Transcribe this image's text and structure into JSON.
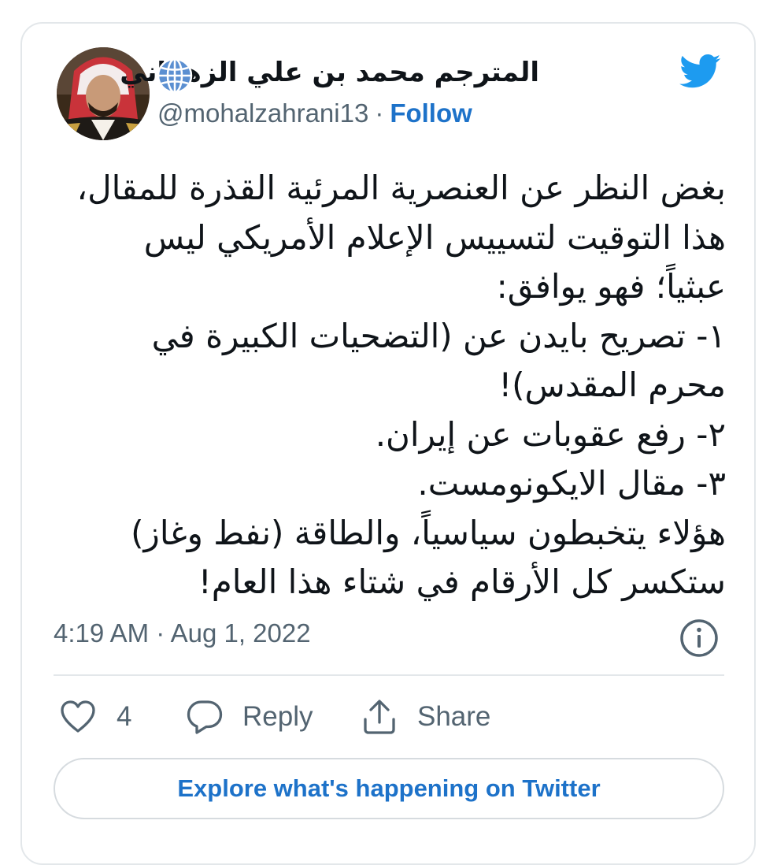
{
  "author": {
    "display_name": "المترجم محمد بن علي الزهراني",
    "handle": "@mohalzahrani13",
    "separator": "·",
    "follow_label": "Follow"
  },
  "tweet": {
    "lines": [
      "بغض النظر عن العنصرية المرئية القذرة للمقال،",
      "هذا التوقيت لتسييس الإعلام الأمريكي ليس",
      "عبثياً؛ فهو يوافق:",
      "١- تصريح بايدن عن (التضحيات الكبيرة في",
      "محرم المقدس)!",
      "٢- رفع عقوبات عن إيران.",
      "٣- مقال الايكونومست.",
      "هؤلاء يتخبطون سياسياً، والطاقة (نفط وغاز)",
      "ستكسر كل الأرقام في شتاء هذا العام!"
    ],
    "time": "4:19 AM",
    "separator": "·",
    "date": "Aug 1, 2022"
  },
  "actions": {
    "like_count": "4",
    "reply_label": "Reply",
    "share_label": "Share"
  },
  "explore_label": "Explore what's happening on Twitter",
  "icons": {
    "brand": "twitter-bird-icon",
    "verified_type": "globe-icon",
    "info": "info-icon",
    "like": "heart-icon",
    "reply": "speech-bubble-icon",
    "share": "upload-arrow-icon"
  },
  "colors": {
    "twitter_blue": "#1d9bf0",
    "link_blue": "#1d72c9",
    "text_primary": "#0f1419",
    "text_secondary": "#536471",
    "border": "#e3e7ea"
  }
}
